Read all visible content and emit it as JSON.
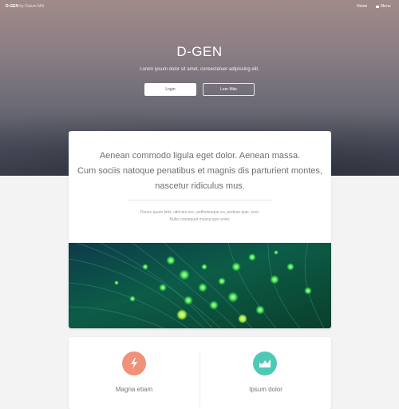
{
  "header": {
    "brand_name": "D-GEN",
    "brand_by": "by Datum Mill",
    "nav": {
      "home": "Home",
      "menu": "Menu"
    }
  },
  "hero": {
    "title": "D-GEN",
    "subtitle": "Lorem ipsum dolor sit amet, consectetuer adipiscing elit.",
    "login_label": "Login",
    "more_label": "Leer Más"
  },
  "intro": {
    "lead_lines": [
      "Aenean commodo ligula eget dolor. Aenean massa.",
      "Cum sociis natoque penatibus et magnis dis parturient montes,",
      "nascetur ridiculus mus."
    ],
    "small_lines": [
      "Donec quam felis, ultricies nec, pellentesque eu, pretium quis, sem.",
      "Nulla consequat massa quis enim."
    ]
  },
  "features": [
    {
      "label": "Magna etiam",
      "icon": "lightning-icon",
      "color": "#f2917a"
    },
    {
      "label": "Ipsum dolor",
      "icon": "area-chart-icon",
      "color": "#4ec9b6"
    }
  ]
}
